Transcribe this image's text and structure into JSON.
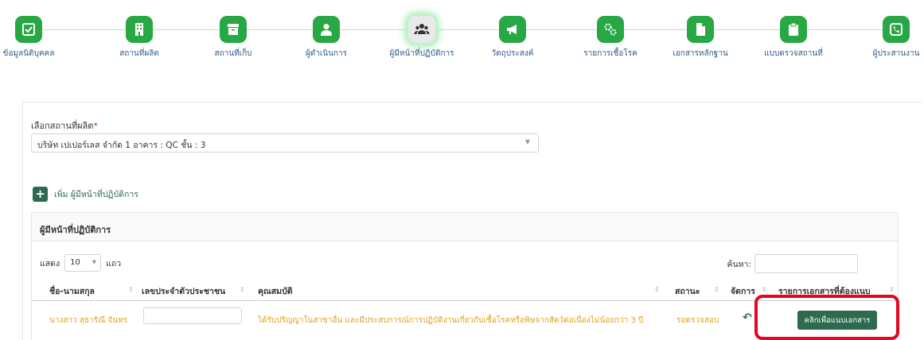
{
  "stepper": {
    "steps": [
      {
        "label": "ข้อมูลนิติบุคคล",
        "icon": "checkbox-icon"
      },
      {
        "label": "สถานที่ผลิต",
        "icon": "building-icon"
      },
      {
        "label": "สถานที่เก็บ",
        "icon": "archive-box-icon"
      },
      {
        "label": "ผู้ดำเนินการ",
        "icon": "user-icon"
      },
      {
        "label": "ผู้มีหน้าที่ปฏิบัติการ",
        "icon": "users-group-icon"
      },
      {
        "label": "วัตถุประสงค์",
        "icon": "megaphone-icon"
      },
      {
        "label": "รายการเชื้อโรค",
        "icon": "gears-icon"
      },
      {
        "label": "เอกสารหลักฐาน",
        "icon": "document-icon"
      },
      {
        "label": "แบบตรวจสถานที่",
        "icon": "clipboard-icon"
      },
      {
        "label": "ผู้ประสานงาน",
        "icon": "phone-icon"
      }
    ],
    "active_index": 4
  },
  "form": {
    "select_label": "เลือกสถานที่ผลิต",
    "required_mark": "*",
    "select_value": "บริษัท เปเปอร์เลส จำกัด 1 อาคาร : QC ชั้น : 3"
  },
  "add": {
    "symbol": "+",
    "label": "เพิ่ม ผู้มีหน้าที่ปฏิบัติการ"
  },
  "table": {
    "title": "ผู้มีหน้าที่ปฏิบัติการ",
    "length_prefix": "แสดง",
    "length_value": "10",
    "length_suffix": "แถว",
    "search_label": "ค้นหา:",
    "headers": {
      "name": "ชื่อ-นามสกุล",
      "id": "เลขประจำตัวประชาชน",
      "qual": "คุณสมบัติ",
      "status": "สถานะ",
      "action": "จัดการ",
      "docs": "รายการเอกสารที่ต้องแนบ"
    },
    "row": {
      "name": "นางสาว สุธารัณี จันทร",
      "qualification": "ได้รับปริญญาในสาขาอื่น และมีประสบการณ์การปฏิบัติงานเกี่ยวกับเชื้อโรคหรือพิษจากสัตว์ต่อเนื่องไม่น้อยกว่า 3 ปี",
      "status": "รอตรวจสอบ",
      "undo_icon": "undo-icon",
      "attach_button": "คลิกเพื่อแนบเอกสาร"
    }
  },
  "colors": {
    "step_green": "#27a844",
    "primary_green": "#2d6a4f",
    "row_text": "#e0a022",
    "highlight_red": "#e1081f"
  }
}
